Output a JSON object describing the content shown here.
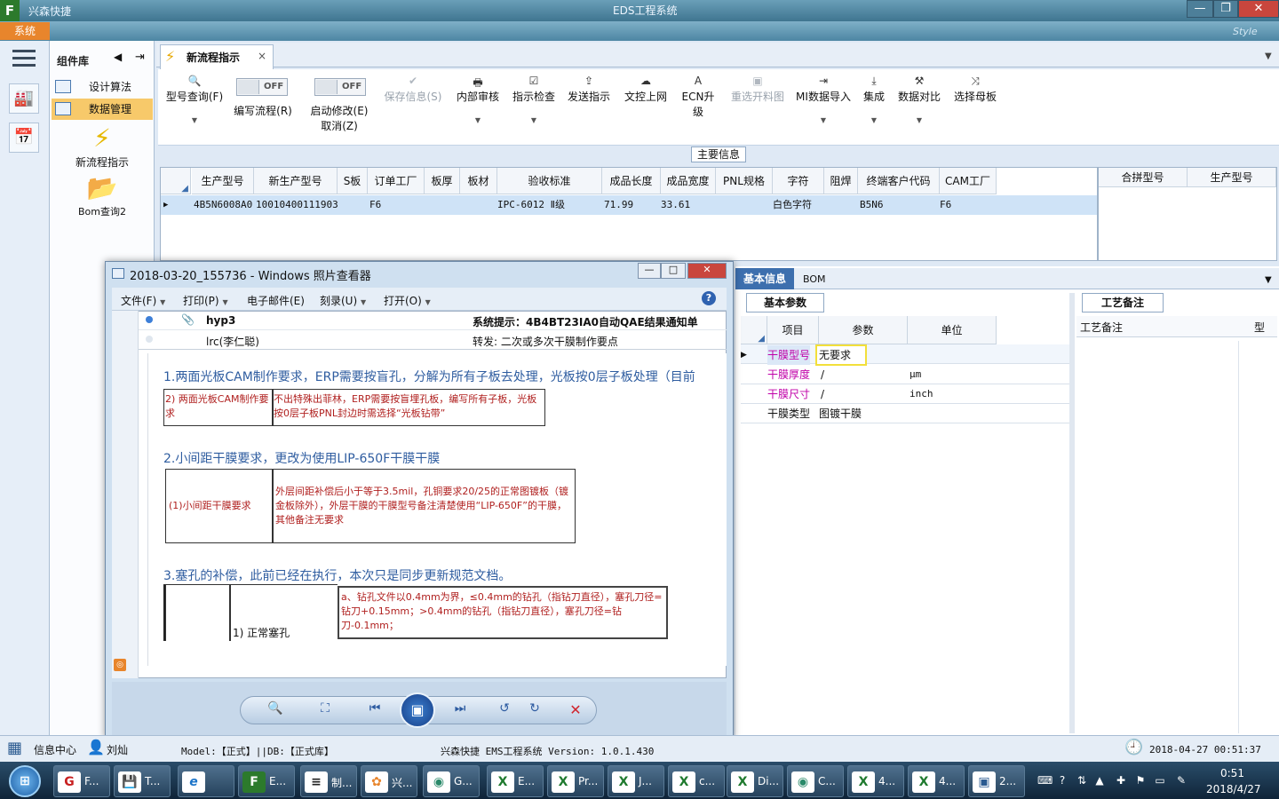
{
  "app": {
    "name": "兴森快捷",
    "window_title": "EDS工程系统",
    "system_tab": "系统",
    "style_label": "Style",
    "window_buttons": {
      "min": "—",
      "max": "❐",
      "close": "✕"
    }
  },
  "component_panel": {
    "title": "组件库",
    "items": [
      {
        "label": "设计算法"
      },
      {
        "label": "数据管理"
      }
    ],
    "tools": [
      {
        "label": "新流程指示",
        "icon": "⚡"
      },
      {
        "label": "Bom查询2",
        "icon": "📂"
      }
    ]
  },
  "doc_tab": {
    "label": "新流程指示",
    "close": "×"
  },
  "ribbon": {
    "query": {
      "label": "型号查询(F)",
      "icon": "🔍"
    },
    "edit_flow": {
      "toggle": "OFF",
      "label": "编写流程(R)"
    },
    "start_modify": {
      "toggle": "OFF",
      "label1": "启动修改(E)",
      "label2": "取消(Z)"
    },
    "buttons": [
      {
        "label": "保存信息(S)",
        "icon": "✔",
        "disabled": true
      },
      {
        "label": "内部审核",
        "icon": "🖶",
        "disabled": false
      },
      {
        "label": "指示检查",
        "icon": "☑",
        "disabled": false
      },
      {
        "label": "发送指示",
        "icon": "⇪",
        "disabled": false
      },
      {
        "label": "文控上网",
        "icon": "☁",
        "disabled": false
      },
      {
        "label": "ECN升级",
        "icon": "A",
        "disabled": false
      },
      {
        "label": "重选开料图",
        "icon": "▣",
        "disabled": true
      },
      {
        "label": "MI数据导入",
        "icon": "⇥",
        "disabled": false
      },
      {
        "label": "集成",
        "icon": "⤓",
        "disabled": false
      },
      {
        "label": "数据对比",
        "icon": "⚒",
        "disabled": false
      },
      {
        "label": "选择母板",
        "icon": "⤨",
        "disabled": false
      }
    ]
  },
  "main_info": {
    "caption": "主要信息",
    "columns": [
      "生产型号",
      "新生产型号",
      "S板",
      "订单工厂",
      "板厚",
      "板材",
      "验收标准",
      "成品长度",
      "成品宽度",
      "PNL规格",
      "字符",
      "阻焊",
      "终端客户代码",
      "CAM工厂"
    ],
    "row": [
      "4B5N6008A0",
      "10010400111903",
      "",
      "F6",
      "",
      "",
      "IPC-6012 Ⅱ级",
      "71.99",
      "33.61",
      "",
      "白色字符",
      "",
      "B5N6",
      "F6"
    ],
    "side_columns": [
      "合拼型号",
      "生产型号"
    ]
  },
  "lower": {
    "tabs": [
      "基本信息",
      "BOM"
    ],
    "params_tab": "基本参数",
    "columns": [
      "项目",
      "参数",
      "单位"
    ],
    "rows": [
      {
        "item": "干膜型号",
        "value": "无要求",
        "unit": ""
      },
      {
        "item": "干膜厚度",
        "value": "/",
        "unit": "μm"
      },
      {
        "item": "干膜尺寸",
        "value": "/",
        "unit": "inch"
      },
      {
        "item": "干膜类型",
        "value": "图镀干膜",
        "unit": ""
      }
    ],
    "process_tab": "工艺备注",
    "process_header": "工艺备注",
    "process_col2": "型"
  },
  "viewer": {
    "title": "2018-03-20_155736 - Windows 照片查看器",
    "menus": [
      "文件(F)",
      "打印(P)",
      "电子邮件(E)",
      "刻录(U)",
      "打开(O)"
    ],
    "help": "?",
    "mail": {
      "from1": "hyp3",
      "subject1": "系统提示：4B4BT23IA0自动QAE结果通知单",
      "from2": "lrc(李仁聪)",
      "subject2": "转发: 二次或多次干膜制作要点"
    },
    "doc": {
      "s1_title": "1.两面光板CAM制作要求，ERP需要按盲孔，分解为所有子板去处理，光板按0层子板处理（目前",
      "s1_left": "2) 两面光板CAM制作要求",
      "s1_right": "不出特殊出菲林，ERP需要按盲埋孔板，编写所有子板，光板按0层子板PNL封边时需选择“光板钻带”",
      "s2_title": "2.小间距干膜要求，更改为使用LIP-650F干膜干膜",
      "s2_left": "(1)小间距干膜要求",
      "s2_right": "外层间距补偿后小于等于3.5mil，孔铜要求20/25的正常图镀板（镀金板除外），外层干膜的干膜型号备注清楚使用“LIP-650F”的干膜，其他备注无要求",
      "s3_title": "3.塞孔的补偿，此前已经在执行，本次只是同步更新规范文档。",
      "s3_left": "1) 正常塞孔",
      "s3_right": "a、钻孔文件以0.4mm为界，≤0.4mm的钻孔（指钻刀直径），塞孔刀径=钻刀+0.15mm；>0.4mm的钻孔（指钻刀直径），塞孔刀径=钻刀-0.1mm；"
    }
  },
  "statusbar": {
    "info_center": "信息中心",
    "user": "刘灿",
    "model": "Model:【正式】||DB:【正式库】",
    "system": "兴森快捷  EMS工程系统  Version: 1.0.1.430",
    "datetime": "2018-04-27 00:51:37"
  },
  "taskbar": {
    "items": [
      {
        "icon": "G",
        "label": "F..."
      },
      {
        "icon": "💾",
        "label": "T..."
      },
      {
        "icon": "e",
        "label": ""
      },
      {
        "icon": "F",
        "label": "E..."
      },
      {
        "icon": "≡",
        "label": "制..."
      },
      {
        "icon": "✿",
        "label": "兴..."
      },
      {
        "icon": "◉",
        "label": "G..."
      },
      {
        "icon": "X",
        "label": "E..."
      },
      {
        "icon": "X",
        "label": "Pr..."
      },
      {
        "icon": "X",
        "label": "J..."
      },
      {
        "icon": "X",
        "label": "c..."
      },
      {
        "icon": "X",
        "label": "Di..."
      },
      {
        "icon": "◉",
        "label": "C..."
      },
      {
        "icon": "X",
        "label": "4..."
      },
      {
        "icon": "X",
        "label": "4..."
      },
      {
        "icon": "▣",
        "label": "2..."
      }
    ],
    "clock_time": "0:51",
    "clock_date": "2018/4/27"
  }
}
